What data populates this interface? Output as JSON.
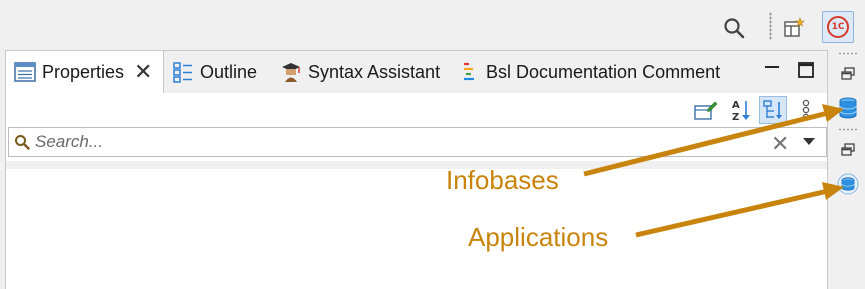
{
  "toolbar": {
    "search_icon": "search-icon",
    "perspective_icon": "open-perspective-icon",
    "app_logo_text": "1C"
  },
  "tabs": [
    {
      "label": "Properties",
      "icon": "properties-icon",
      "active": true
    },
    {
      "label": "Outline",
      "icon": "outline-icon",
      "active": false
    },
    {
      "label": "Syntax Assistant",
      "icon": "syntax-assistant-icon",
      "active": false
    },
    {
      "label": "Bsl Documentation Comment",
      "icon": "bsl-doc-comment-icon",
      "active": false
    }
  ],
  "search": {
    "placeholder": "Search...",
    "value": ""
  },
  "annotations": {
    "infobases": "Infobases",
    "applications": "Applications"
  },
  "colors": {
    "annotation": "#c8840c",
    "accent": "#2d7fd3",
    "logo_red": "#d73b2c"
  }
}
